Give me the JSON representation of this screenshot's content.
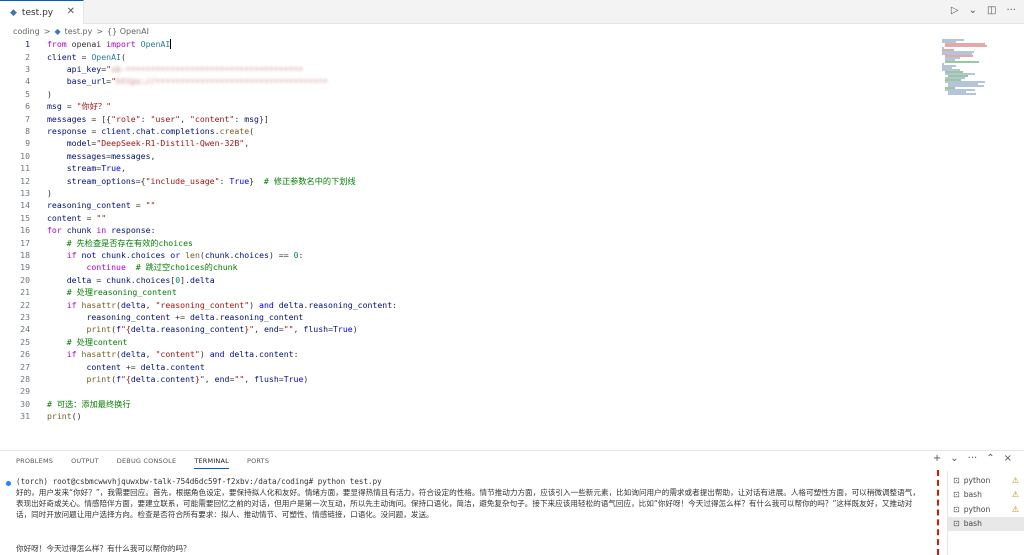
{
  "tab": {
    "icon": "python-file-icon",
    "label": "test.py"
  },
  "tab_actions": [
    "run-icon",
    "chevron-down-icon",
    "split-editor-icon",
    "more-icon"
  ],
  "breadcrumb": {
    "folder": "coding",
    "sep": ">",
    "file": "test.py",
    "symbol": "{} OpenAI"
  },
  "editor": {
    "lines": [
      {
        "n": "1",
        "html": "<span class='kwc'>from</span> openai <span class='kwc'>import</span> <span class='cls'>OpenAI</span><span class='cursor'></span>"
      },
      {
        "n": "2",
        "html": "<span class='var'>client</span> = <span class='cls'>OpenAI</span>("
      },
      {
        "n": "3",
        "html": "    <span class='var'>api_key</span>=<span class='str'>\"</span><span class='blur'>sk-••••••••••••••••••••••••••••••••••••</span>"
      },
      {
        "n": "4",
        "html": "    <span class='var'>base_url</span>=<span class='str'>\"</span><span class='blur'>https://•••••••••••••••••••••••••••••••••••</span>"
      },
      {
        "n": "5",
        "html": ")"
      },
      {
        "n": "6",
        "html": "<span class='var'>msg</span> = <span class='str'>\"你好？\"</span>"
      },
      {
        "n": "7",
        "html": "<span class='var'>messages</span> = [{<span class='str'>\"role\"</span>: <span class='str'>\"user\"</span>, <span class='str'>\"content\"</span>: <span class='var'>msg</span>}]"
      },
      {
        "n": "8",
        "html": "<span class='var'>response</span> = <span class='var'>client</span>.<span class='var'>chat</span>.<span class='var'>completions</span>.<span class='fn'>create</span>("
      },
      {
        "n": "9",
        "html": "    <span class='var'>model</span>=<span class='str'>\"DeepSeek-R1-Distill-Qwen-32B\"</span>,"
      },
      {
        "n": "10",
        "html": "    <span class='var'>messages</span>=<span class='var'>messages</span>,"
      },
      {
        "n": "11",
        "html": "    <span class='var'>stream</span>=<span class='kw'>True</span>,"
      },
      {
        "n": "12",
        "html": "    <span class='var'>stream_options</span>={<span class='str'>\"include_usage\"</span>: <span class='kw'>True</span>}  <span class='cmt'># 修正参数名中的下划线</span>"
      },
      {
        "n": "13",
        "html": ")"
      },
      {
        "n": "14",
        "html": "<span class='var'>reasoning_content</span> = <span class='str'>\"\"</span>"
      },
      {
        "n": "15",
        "html": "<span class='var'>content</span> = <span class='str'>\"\"</span>"
      },
      {
        "n": "16",
        "html": "<span class='kwc'>for</span> <span class='var'>chunk</span> <span class='kwc'>in</span> <span class='var'>response</span>:"
      },
      {
        "n": "17",
        "html": "    <span class='cmt'># 先检查是否存在有效的choices</span>"
      },
      {
        "n": "18",
        "html": "    <span class='kwc'>if</span> <span class='kw'>not</span> <span class='var'>chunk</span>.<span class='var'>choices</span> <span class='kw'>or</span> <span class='fn'>len</span>(<span class='var'>chunk</span>.<span class='var'>choices</span>) == <span class='num'>0</span>:"
      },
      {
        "n": "19",
        "html": "        <span class='kwc'>continue</span>  <span class='cmt'># 跳过空choices的chunk</span>"
      },
      {
        "n": "20",
        "html": "    <span class='var'>delta</span> = <span class='var'>chunk</span>.<span class='var'>choices</span>[<span class='num'>0</span>].<span class='var'>delta</span>"
      },
      {
        "n": "21",
        "html": "    <span class='cmt'># 处理reasoning_content</span>"
      },
      {
        "n": "22",
        "html": "    <span class='kwc'>if</span> <span class='fn'>hasattr</span>(<span class='var'>delta</span>, <span class='str'>\"reasoning_content\"</span>) <span class='kw'>and</span> <span class='var'>delta</span>.<span class='var'>reasoning_content</span>:"
      },
      {
        "n": "23",
        "html": "        <span class='var'>reasoning_content</span> += <span class='var'>delta</span>.<span class='var'>reasoning_content</span>"
      },
      {
        "n": "24",
        "html": "        <span class='fn'>print</span>(<span class='kw'>f</span><span class='str'>\"{</span><span class='var'>delta</span>.<span class='var'>reasoning_content</span><span class='str'>}\"</span>, <span class='var'>end</span>=<span class='str'>\"\"</span>, <span class='var'>flush</span>=<span class='kw'>True</span>)"
      },
      {
        "n": "25",
        "html": "    <span class='cmt'># 处理content</span>"
      },
      {
        "n": "26",
        "html": "    <span class='kwc'>if</span> <span class='fn'>hasattr</span>(<span class='var'>delta</span>, <span class='str'>\"content\"</span>) <span class='kw'>and</span> <span class='var'>delta</span>.<span class='var'>content</span>:"
      },
      {
        "n": "27",
        "html": "        <span class='var'>content</span> += <span class='var'>delta</span>.<span class='var'>content</span>"
      },
      {
        "n": "28",
        "html": "        <span class='fn'>print</span>(<span class='kw'>f</span><span class='str'>\"{</span><span class='var'>delta</span>.<span class='var'>content</span><span class='str'>}\"</span>, <span class='var'>end</span>=<span class='str'>\"\"</span>, <span class='var'>flush</span>=<span class='kw'>True</span>)"
      },
      {
        "n": "29",
        "html": ""
      },
      {
        "n": "30",
        "html": "<span class='cmt'># 可选：添加最终换行</span>"
      },
      {
        "n": "31",
        "html": "<span class='fn'>print</span>()"
      }
    ]
  },
  "panel": {
    "tabs": [
      "PROBLEMS",
      "OUTPUT",
      "DEBUG CONSOLE",
      "TERMINAL",
      "PORTS"
    ],
    "active_tab": "TERMINAL",
    "actions": [
      "+",
      "⌄",
      "···",
      "⌃",
      "×"
    ]
  },
  "terminal": {
    "prompt": "(torch) root@csbmcwwvhjquwxbw-talk-754d6dc59f-f2xbv:/data/coding# python test.py",
    "output": "好的，用户发来“你好？”，我需要回应。首先，根据角色设定，要保持拟人化和友好。情绪方面，要显得热情且有活力，符合设定的性格。情节推动力方面，应该引入一些新元素，比如询问用户的需求或者提出帮助，让对话有进展。人格可塑性方面，可以稍微调整语气，表现出好奇或关心。情感陪伴方面，要建立联系，可能需要回忆之前的对话，但用户是第一次互动，所以先主动询问。保持口语化，简洁，避免复杂句子。接下来应该用轻松的语气回应，比如“你好呀！今天过得怎么样？有什么我可以帮你的吗？”这样既友好，又推动对话，同时开放问题让用户选择方向。检查是否符合所有要求：拟人、推动情节、可塑性、情感链接，口语化。没问题，发送。",
    "answer": "你好呀！今天过得怎么样？有什么我可以帮你的吗？"
  },
  "terminal_list": [
    {
      "label": "python",
      "warn": true,
      "selected": false
    },
    {
      "label": "bash",
      "warn": true,
      "selected": false
    },
    {
      "label": "python",
      "warn": true,
      "selected": false
    },
    {
      "label": "bash",
      "warn": false,
      "selected": true
    }
  ],
  "colors": {
    "accent": "#005fb8",
    "keyword": "#0000ff",
    "string": "#a31515",
    "comment": "#008000"
  }
}
